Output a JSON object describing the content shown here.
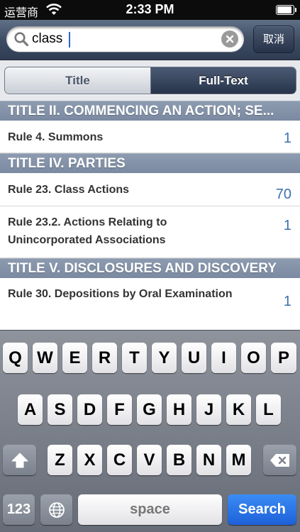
{
  "status_bar": {
    "carrier": "运营商",
    "time": "2:33 PM",
    "battery_level": 0.9
  },
  "search": {
    "query": "class",
    "cancel_label": "取消",
    "icons": {
      "search": "search-icon",
      "clear": "clear-icon"
    }
  },
  "segments": {
    "title": "Title",
    "full_text": "Full-Text",
    "selected": "Full-Text"
  },
  "results": [
    {
      "section": "TITLE II. COMMENCING AN ACTION; SE...",
      "rows": [
        {
          "text": "Rule 4. Summons",
          "count": "1"
        }
      ]
    },
    {
      "section": "TITLE IV. PARTIES",
      "rows": [
        {
          "text": "Rule 23. Class Actions",
          "count": "70"
        },
        {
          "text": "Rule 23.2. Actions Relating to Unincorporated Associations",
          "count": "1"
        }
      ]
    },
    {
      "section": "TITLE V. DISCLOSURES AND DISCOVERY",
      "rows": [
        {
          "text": "Rule 30. Depositions by Oral Examination",
          "count": "1"
        }
      ]
    }
  ],
  "keyboard": {
    "row1": [
      "Q",
      "W",
      "E",
      "R",
      "T",
      "Y",
      "U",
      "I",
      "O",
      "P"
    ],
    "row2": [
      "A",
      "S",
      "D",
      "F",
      "G",
      "H",
      "J",
      "K",
      "L"
    ],
    "row3": [
      "Z",
      "X",
      "C",
      "V",
      "B",
      "N",
      "M"
    ],
    "numbers_key": "123",
    "space_key": "space",
    "search_key": "Search",
    "icons": {
      "shift": "shift-icon",
      "delete": "delete-icon",
      "globe": "globe-icon"
    }
  }
}
